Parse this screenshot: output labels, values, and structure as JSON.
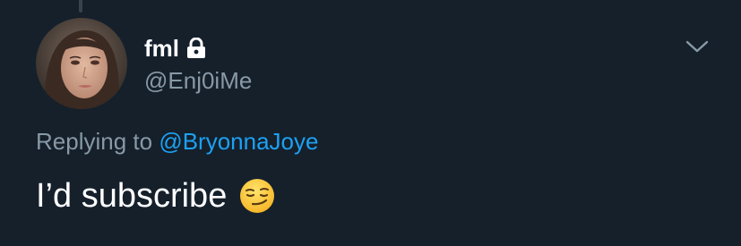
{
  "tweet": {
    "display_name": "fml",
    "handle": "@Enj0iMe",
    "replying_prefix": "Replying to",
    "replying_to": "@BryonnaJoye",
    "text": "I’d subscribe",
    "emoji": "smirking-face-emoji",
    "protected": true
  },
  "colors": {
    "background": "#15202b",
    "primary_text": "#ffffff",
    "secondary_text": "#8899a6",
    "link": "#1da1f2"
  }
}
